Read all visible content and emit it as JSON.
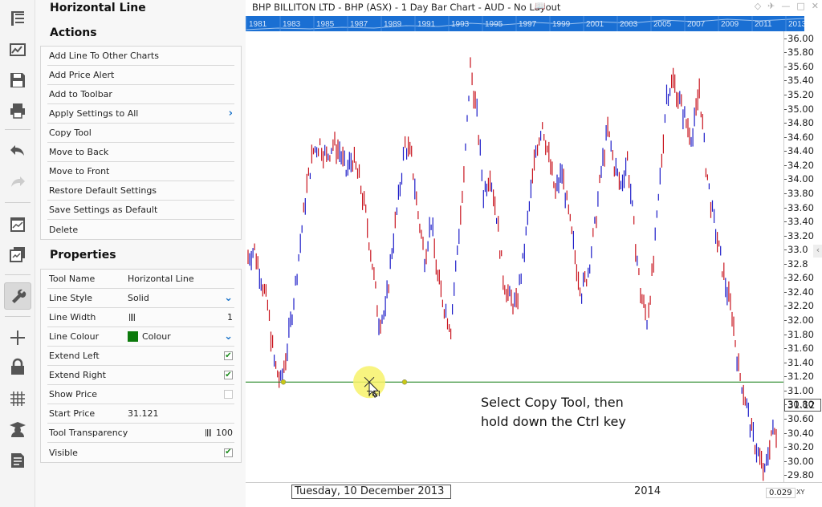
{
  "left_toolbar": {
    "icons": [
      "templates-icon",
      "chart-wizard-icon",
      "save-icon",
      "print-icon",
      "undo-icon",
      "redo-icon",
      "chart-properties-icon",
      "layers-icon",
      "tools-icon",
      "crosshair-icon",
      "lock-icon",
      "grid-icon",
      "education-icon",
      "notes-icon"
    ]
  },
  "panel": {
    "tool_title": "Horizontal Line",
    "actions_title": "Actions",
    "actions": [
      "Add Line To Other Charts",
      "Add Price Alert",
      "Add to Toolbar",
      "Apply Settings to All",
      "Copy Tool",
      "Move to Back",
      "Move to Front",
      "Restore Default Settings",
      "Save Settings as Default",
      "Delete"
    ],
    "properties_title": "Properties",
    "properties": {
      "tool_name": {
        "label": "Tool Name",
        "value": "Horizontal Line"
      },
      "line_style": {
        "label": "Line Style",
        "value": "Solid"
      },
      "line_width": {
        "label": "Line Width",
        "value": "1"
      },
      "line_colour": {
        "label": "Line Colour",
        "value": "Colour",
        "color": "#0c7a0c"
      },
      "extend_left": {
        "label": "Extend Left",
        "checked": true
      },
      "extend_right": {
        "label": "Extend Right",
        "checked": true
      },
      "show_price": {
        "label": "Show Price",
        "checked": false
      },
      "start_price": {
        "label": "Start Price",
        "value": "31.121"
      },
      "tool_transparency": {
        "label": "Tool Transparency",
        "value": "100"
      },
      "visible": {
        "label": "Visible",
        "checked": true
      }
    }
  },
  "chart": {
    "title": "BHP BILLITON LTD - BHP (ASX) - 1 Day Bar Chart - AUD - No Layout",
    "timeline_years": [
      "1981",
      "1983",
      "1985",
      "1987",
      "1989",
      "1991",
      "1993",
      "1995",
      "1997",
      "1999",
      "2001",
      "2003",
      "2005",
      "2007",
      "2009",
      "2011",
      "2013"
    ],
    "price_labels": [
      "36.00",
      "35.80",
      "35.60",
      "35.40",
      "35.20",
      "35.00",
      "34.80",
      "34.60",
      "34.40",
      "34.20",
      "34.00",
      "33.80",
      "33.60",
      "33.40",
      "33.20",
      "33.0",
      "32.8",
      "32.60",
      "32.40",
      "32.20",
      "32.00",
      "31.80",
      "31.60",
      "31.40",
      "31.20",
      "31.00",
      "30.80",
      "30.60",
      "30.40",
      "30.20",
      "30.00",
      "29.80"
    ],
    "price_marker": "31.12",
    "cursor_date": "Tuesday, 10 December 2013",
    "year_label": "2014",
    "scale_value": "0.029",
    "scale_xy": "XY",
    "annotation_line1": "Select Copy Tool, then",
    "annotation_line2": "hold down the Ctrl key",
    "cursor_tool_label": "T&I",
    "colors": {
      "up_bar": "#1c1cc8",
      "down_bar": "#c8141e",
      "horizontal_line": "#0c7a0c",
      "timeline": "#1a6fd3"
    }
  },
  "chart_data": {
    "type": "bar",
    "ylim": [
      29.7,
      36.1
    ],
    "horizontal_line_price": 31.121,
    "x_labels": [
      "2014"
    ],
    "ohlc_close_sketch": [
      32.9,
      33.0,
      32.6,
      32.2,
      31.4,
      31.1,
      31.6,
      32.3,
      33.1,
      33.9,
      34.4,
      34.5,
      34.3,
      34.5,
      34.4,
      34.1,
      34.3,
      34.0,
      33.5,
      32.8,
      32.0,
      32.1,
      33.0,
      33.7,
      34.5,
      34.3,
      33.5,
      32.9,
      33.4,
      32.6,
      32.2,
      31.9,
      33.0,
      34.0,
      35.6,
      34.9,
      33.8,
      34.1,
      33.5,
      32.6,
      32.3,
      32.2,
      32.8,
      33.6,
      34.4,
      34.8,
      34.3,
      33.8,
      34.1,
      33.5,
      32.9,
      32.4,
      32.7,
      33.3,
      34.1,
      34.7,
      34.2,
      33.9,
      34.3,
      33.3,
      32.4,
      32.0,
      32.8,
      34.0,
      35.2,
      35.4,
      35.1,
      34.8,
      34.6,
      35.3,
      34.2,
      33.5,
      33.0,
      32.5,
      32.1,
      31.3,
      30.9,
      30.4,
      30.1,
      29.8,
      30.4
    ]
  }
}
